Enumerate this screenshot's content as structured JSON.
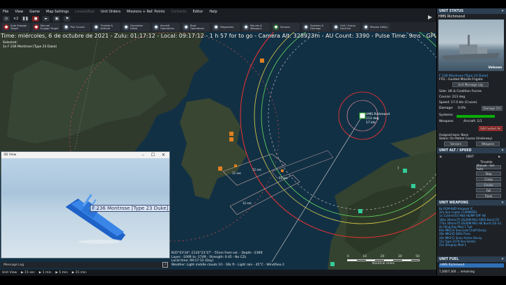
{
  "menu": [
    "File",
    "View",
    "Game",
    "Map Settings",
    "Losses/Exp",
    "Unit Orders",
    "Missions + Ref. Points",
    "Contacts",
    "Editor",
    "Help"
  ],
  "menu_dim": [
    4,
    7
  ],
  "controls": {
    "speed": "×2"
  },
  "toolbar": [
    {
      "icon": "auto-engage-icon",
      "label": "Auto Engage Target",
      "color": "red"
    },
    {
      "icon": "manual-engage-icon",
      "label": "Manual Engage Target",
      "color": "red"
    },
    {
      "icon": "plot-course-icon",
      "label": "Plot Course",
      "color": "blue"
    },
    {
      "icon": "throttle-icon",
      "label": "Throttle & Altitude",
      "color": "blue"
    },
    {
      "icon": "formation-icon",
      "label": "Formation Editor",
      "color": "blue"
    },
    {
      "icon": "aircraft-icon",
      "label": "Aircraft Operations",
      "color": "blue"
    },
    {
      "icon": "boat-icon",
      "label": "Boat Operations",
      "color": "blue"
    },
    {
      "icon": "magazines-icon",
      "label": "Magazines",
      "color": "blue"
    },
    {
      "icon": "mounts-icon",
      "label": "Mounts & Weapons",
      "color": "blue"
    },
    {
      "icon": "sensors-icon",
      "label": "Sensors",
      "color": "grn"
    },
    {
      "icon": "systems-icon",
      "label": "Systems & Damage",
      "color": "blue"
    },
    {
      "icon": "doctrine-icon",
      "label": "Unit / Group Doctrine",
      "color": "blue"
    },
    {
      "icon": "mission-icon",
      "label": "Mission Editor",
      "color": "blue"
    }
  ],
  "status_line": "Time: miércoles, 6 de octubre de 2021 - Zulu: 01:17:12 - Local: 09:17:12 - 1 h 57 for to go - Camera Alt: 328923m - AU Count: 3390 - Pulse Time: 9ms - GPU: NVIDIA GeForce RTX 2060",
  "selected_label": "Selected:",
  "selected_unit": "1x F 236 Montrose [Type 23 Duke]",
  "map_unit": {
    "name": "HMS Richmond",
    "course": "213 deg",
    "speed": "17 kts"
  },
  "map_labels": [
    "12 sec",
    "12 sec",
    "12 sec",
    "12 sec",
    "7"
  ],
  "view3d": {
    "title": "3D View",
    "ship_label": "F 236 Montrose [Type 23 Duke] (HMS"
  },
  "coord_info": [
    "N35°03'34\", E120°23'37\" - 55nm from sel. - Depth: -236ft",
    "Layer: -100ft to -174ft - Strength: 0.45 - No CZs",
    "Local time: 09:17:12 (Day)",
    "Weather: Light middle clouds 10 - 16k ft - Light rain - 45°C - Wind/Sea 2"
  ],
  "scale": {
    "ticks": [
      "0",
      "10",
      "20",
      "30",
      "50"
    ],
    "unit": "Nautical miles"
  },
  "message_log": "Message Log",
  "timebar": {
    "label": "Unit View",
    "steps": [
      "15 sec",
      "1 min",
      "5 min",
      "15 min"
    ]
  },
  "panel": {
    "status_header": "UNIT STATUS",
    "ship_name": "HMS Richmond",
    "photo_caption": "Veloxas",
    "unit_id": "F 236 Montrose [Type 23 Duke]",
    "unit_type": "FFG - Guided Missile Frigate",
    "message_log_btn": "Unit Message Log",
    "side": "Side: UK & Coalition Forces",
    "course": "Course: 213 deg",
    "speed": "Speed: 17.0 kts (Cruise)",
    "damage_label": "Damage:",
    "damage_value": "0.0%",
    "damage_btn": "Damage Ctrl",
    "systems_label": "Systems:",
    "weapons_label": "Weapons",
    "aircraft_label": "Aircraft: 1/1",
    "edit_btn": "Edit hosted Air",
    "assigned_base": "Assigned base: None",
    "status_text": "Status: On Plotted Course (Underway)",
    "sensors_btn": "Sensors",
    "weapons_btn": "Weapons",
    "altspeed_header": "UNIT ALT / SPEED",
    "unit_label": "UNIT",
    "throttle_label": "Throttle",
    "throttle_value": "Manual - Set Auto",
    "speed_buttons": [
      "Stop",
      "Creep",
      "Cruise",
      "Full",
      "Flank"
    ],
    "weapons_header": "UNIT WEAPONS",
    "weapons": [
      "8x RGM-84D Harpoon IC",
      "32x Sea Ceptor [CAMM/ER]",
      "1x 114mm/55 Mk8 HE/MP SPF HE",
      "160x 30mm/75 DS30M Mk1 APDS Burst [5]",
      "774x 30mm/75 DS30M Mk1 HE Burst [10 rn]",
      "4x Sting Ray Mod 1 Tpd",
      "64x MK214 Sea Gnat Chaff Decoy",
      "28x MK245 DIAG Flare",
      "20x MK251 Siren Active Decoy",
      "11x Type 2170 Sea Sentor",
      "22x Stingray Mod 1"
    ],
    "fuel_header": "UNIT FUEL",
    "fuel_unit": "HMS Richmond",
    "fuel_text": "7,300/7,300 ... remaining"
  }
}
